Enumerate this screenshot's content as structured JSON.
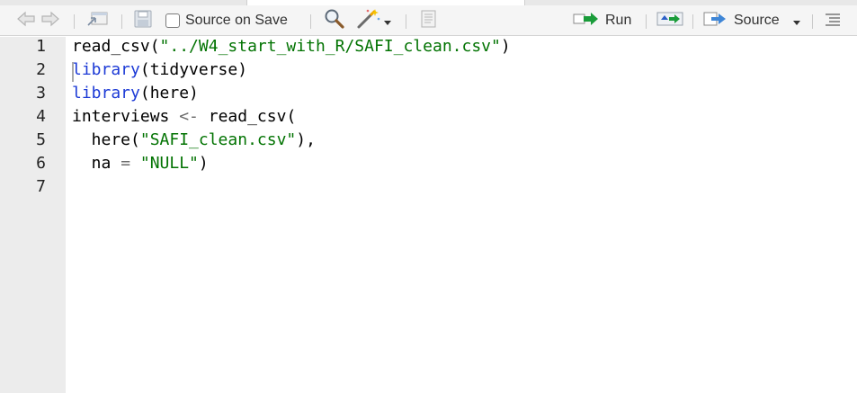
{
  "toolbar": {
    "back_icon": "arrow-left-icon",
    "forward_icon": "arrow-right-icon",
    "show_in_window_icon": "show-in-window-icon",
    "save_icon": "save-disk-icon",
    "source_on_save_label": "Source on Save",
    "source_on_save_checked": false,
    "find_icon": "magnifier-icon",
    "code_tools_icon": "magic-wand-icon",
    "compile_report_icon": "notebook-icon",
    "run_label": "Run",
    "run_icon": "run-arrow-icon",
    "rerun_icon": "rerun-icon",
    "source_label": "Source",
    "source_icon": "source-arrow-icon",
    "outline_icon": "document-outline-icon"
  },
  "editor": {
    "lines": [
      {
        "num": "1",
        "parts": [
          {
            "t": "read_csv(",
            "c": "plain"
          },
          {
            "t": "\"../W4_start_with_R/SAFI_clean.csv\"",
            "c": "str"
          },
          {
            "t": ")",
            "c": "plain"
          }
        ]
      },
      {
        "num": "2",
        "parts": [
          {
            "t": "library",
            "c": "kw"
          },
          {
            "t": "(tidyverse)",
            "c": "plain"
          }
        ]
      },
      {
        "num": "3",
        "parts": [
          {
            "t": "library",
            "c": "kw"
          },
          {
            "t": "(here)",
            "c": "plain"
          }
        ]
      },
      {
        "num": "4",
        "parts": [
          {
            "t": "interviews ",
            "c": "plain"
          },
          {
            "t": "<-",
            "c": "op"
          },
          {
            "t": " read_csv(",
            "c": "plain"
          }
        ]
      },
      {
        "num": "5",
        "parts": [
          {
            "t": "  here(",
            "c": "plain"
          },
          {
            "t": "\"SAFI_clean.csv\"",
            "c": "str"
          },
          {
            "t": "),",
            "c": "plain"
          }
        ]
      },
      {
        "num": "6",
        "parts": [
          {
            "t": "  na ",
            "c": "plain"
          },
          {
            "t": "=",
            "c": "op"
          },
          {
            "t": " ",
            "c": "plain"
          },
          {
            "t": "\"NULL\"",
            "c": "str"
          },
          {
            "t": ")",
            "c": "plain"
          }
        ]
      },
      {
        "num": "7",
        "parts": []
      }
    ]
  },
  "colors": {
    "keyword": "#1c3ad6",
    "string": "#027302",
    "operator": "#6b6b6b",
    "run_green": "#1a9c3a",
    "gutter": "#ececec"
  }
}
